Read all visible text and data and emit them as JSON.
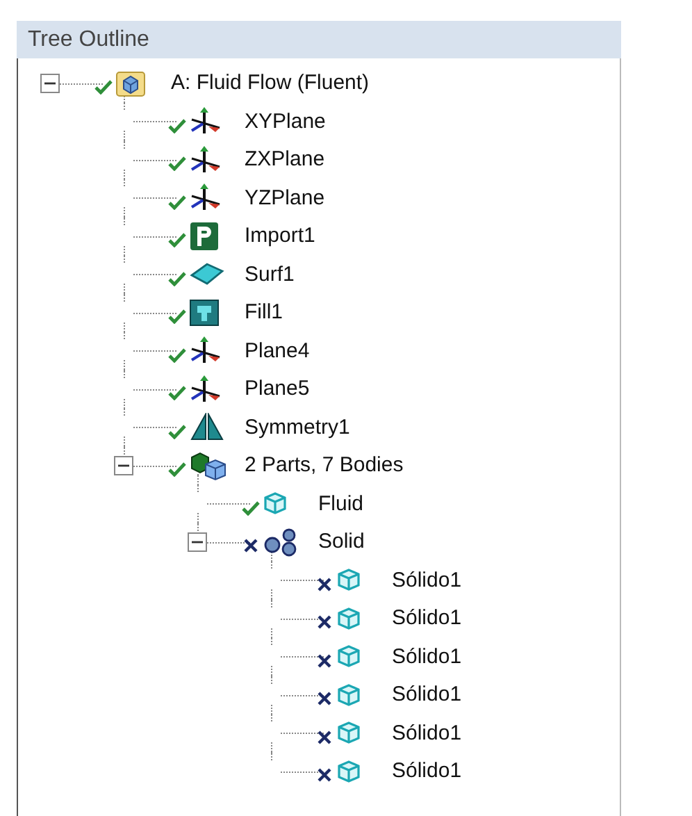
{
  "panel": {
    "title": "Tree Outline"
  },
  "tree": [
    {
      "label": "A: Fluid Flow (Fluent)",
      "kind": "geometry",
      "valid": true,
      "expanded": true,
      "children": [
        {
          "label": "XYPlane",
          "kind": "plane",
          "valid": true
        },
        {
          "label": "ZXPlane",
          "kind": "plane",
          "valid": true
        },
        {
          "label": "YZPlane",
          "kind": "plane",
          "valid": true
        },
        {
          "label": "Import1",
          "kind": "import",
          "valid": true
        },
        {
          "label": "Surf1",
          "kind": "surface",
          "valid": true
        },
        {
          "label": "Fill1",
          "kind": "fill",
          "valid": true
        },
        {
          "label": "Plane4",
          "kind": "plane",
          "valid": true
        },
        {
          "label": "Plane5",
          "kind": "plane",
          "valid": true
        },
        {
          "label": "Symmetry1",
          "kind": "symmetry",
          "valid": true
        },
        {
          "label": "2 Parts, 7 Bodies",
          "kind": "parts",
          "valid": true,
          "expanded": true,
          "children": [
            {
              "label": "Fluid",
              "kind": "body",
              "valid": true
            },
            {
              "label": "Solid",
              "kind": "multibody",
              "valid": false,
              "expanded": true,
              "children": [
                {
                  "label": "Sólido1",
                  "kind": "body",
                  "valid": false
                },
                {
                  "label": "Sólido1",
                  "kind": "body",
                  "valid": false
                },
                {
                  "label": "Sólido1",
                  "kind": "body",
                  "valid": false
                },
                {
                  "label": "Sólido1",
                  "kind": "body",
                  "valid": false
                },
                {
                  "label": "Sólido1",
                  "kind": "body",
                  "valid": false
                },
                {
                  "label": "Sólido1",
                  "kind": "body",
                  "valid": false
                }
              ]
            }
          ]
        }
      ]
    }
  ]
}
